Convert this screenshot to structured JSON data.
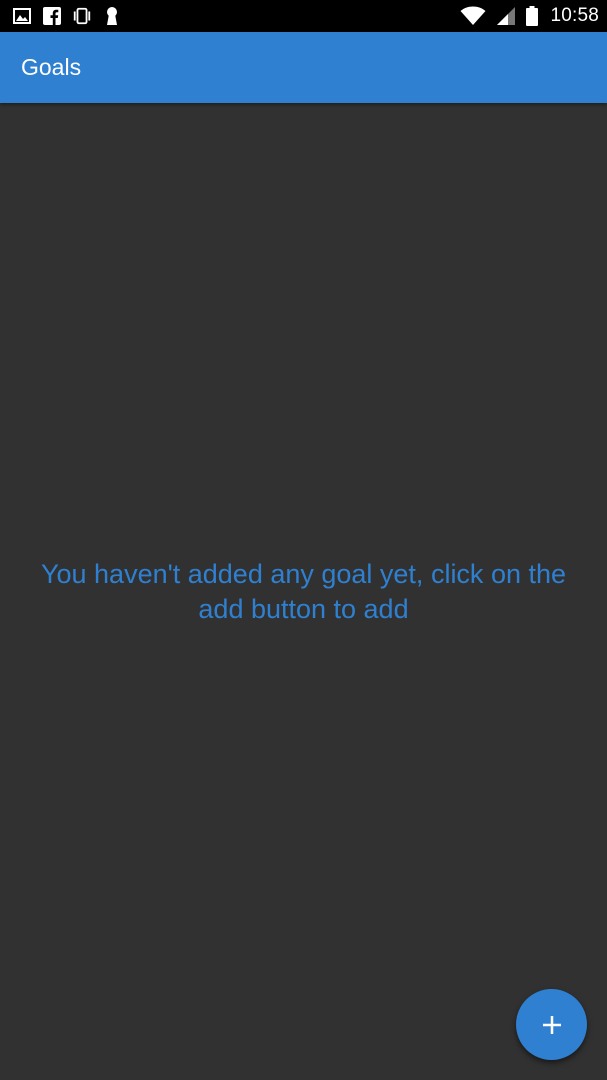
{
  "status_bar": {
    "time": "10:58",
    "left_icons": [
      "image-icon",
      "facebook-icon",
      "vibrate-icon",
      "keyhole-icon"
    ],
    "right_icons": [
      "wifi-icon",
      "signal-icon",
      "battery-icon"
    ]
  },
  "app_bar": {
    "title": "Goals",
    "color": "#2f80d0"
  },
  "main": {
    "empty_message": "You haven't added any goal yet, click on the add button to add",
    "background": "#313131"
  },
  "fab": {
    "icon": "plus-icon",
    "color": "#2f80d0"
  }
}
